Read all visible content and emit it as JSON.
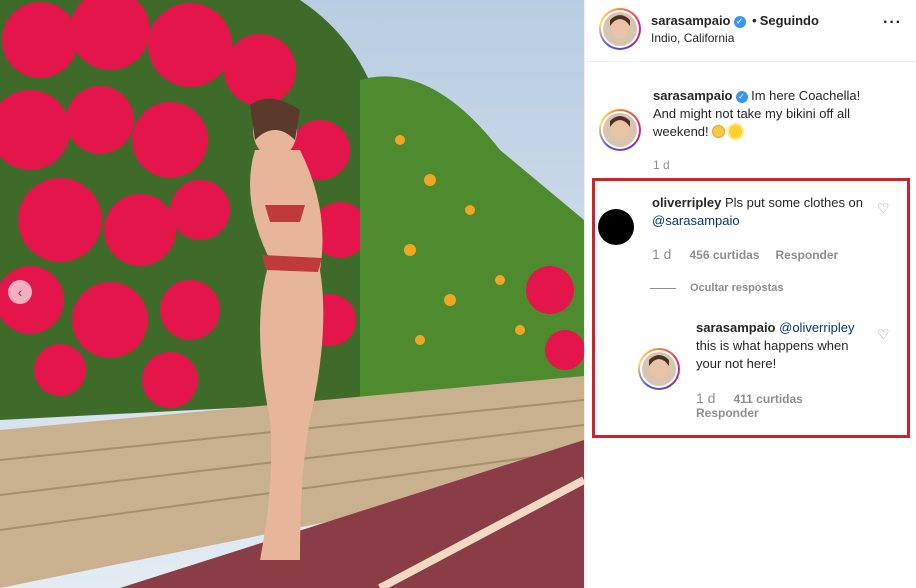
{
  "post": {
    "username": "sarasampaio",
    "follow_state": "Seguindo",
    "separator": "•",
    "location": "Indio, California",
    "more_icon": "more-horizontal-icon"
  },
  "caption": {
    "username": "sarasampaio",
    "text": "Im here Coachella! And might not take my bikini off all weekend!",
    "emojis": [
      "smiling-face-emoji",
      "sun-emoji"
    ],
    "time": "1 d"
  },
  "comments": [
    {
      "username": "oliverripley",
      "text": "Pls put some clothes on",
      "mention": "@sarasampaio",
      "time": "1 d",
      "likes": "456 curtidas",
      "reply_label": "Responder"
    }
  ],
  "hide_replies_label": "Ocultar respostas",
  "reply": {
    "username": "sarasampaio",
    "mention": "@oliverripley",
    "text": "this is what happens when your not here!",
    "time": "1 d",
    "likes": "411 curtidas",
    "reply_label": "Responder"
  },
  "colors": {
    "highlight_border": "#d0202a",
    "verified_blue": "#3897f0",
    "mention_blue": "#00376b",
    "muted_text": "#8e8e8e"
  }
}
